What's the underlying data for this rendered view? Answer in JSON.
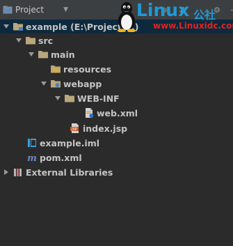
{
  "header": {
    "view_label": "Project"
  },
  "tree": {
    "root_label": "example (E:\\Project\\...)",
    "src_label": "src",
    "main_label": "main",
    "resources_label": "resources",
    "webapp_label": "webapp",
    "webinf_label": "WEB-INF",
    "webxml_label": "web.xml",
    "indexjsp_label": "index.jsp",
    "iml_label": "example.iml",
    "pom_label": "pom.xml",
    "external_label": "External Libraries"
  },
  "watermark": {
    "brand": "Linux",
    "brand_suffix": "公社",
    "url": "www.Linuxidc.com"
  },
  "colors": {
    "background": "#2b2b2b",
    "header": "#3c3f41",
    "selection": "#0d293e",
    "folder": "#b9a77d",
    "source_folder": "#6f9fd1",
    "brand": "#1e9ad6",
    "url": "#e3231b"
  },
  "icons": [
    "project-view-icon",
    "chevron-down-icon",
    "expanded-arrow-icon",
    "collapsed-arrow-icon",
    "module-folder-icon",
    "folder-icon",
    "source-folder-icon",
    "resources-folder-icon",
    "web-folder-icon",
    "xml-file-icon",
    "jsp-file-icon",
    "iml-file-icon",
    "maven-pom-icon",
    "libraries-icon",
    "tux-penguin-icon"
  ]
}
